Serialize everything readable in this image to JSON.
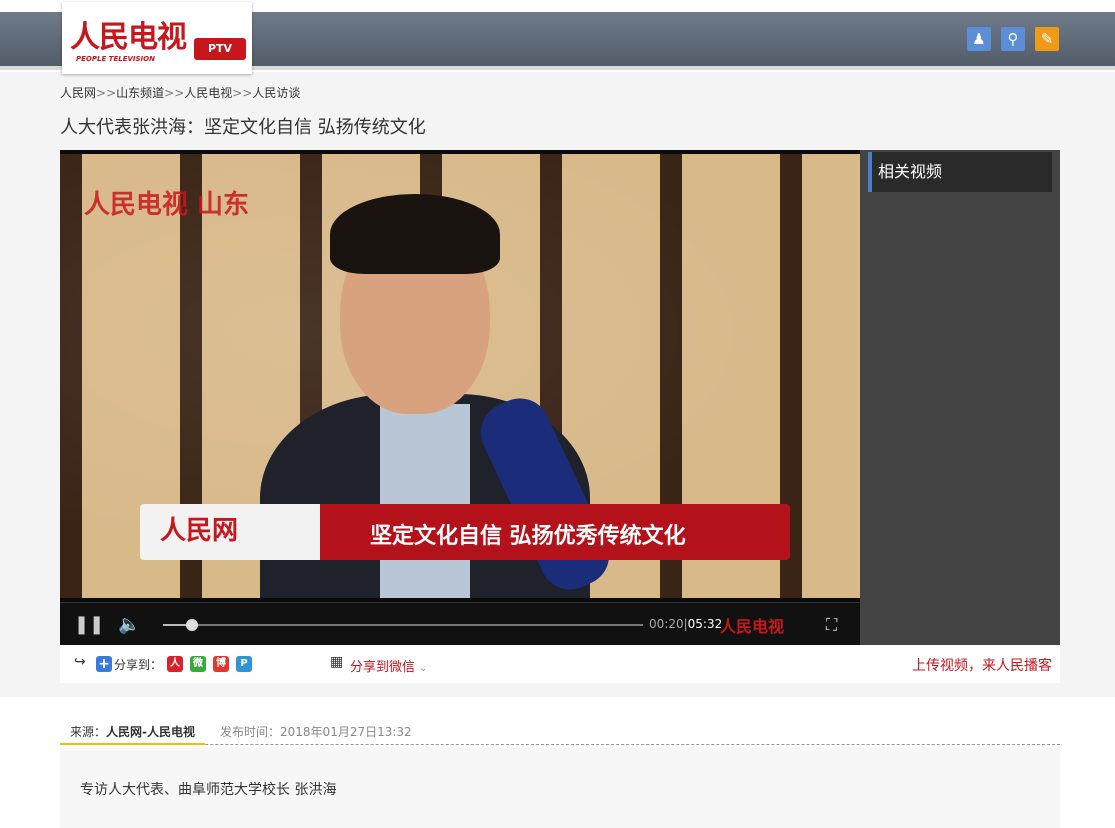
{
  "header": {
    "logo_text": "人民电视",
    "logo_badge": "PTV",
    "logo_sub": "PEOPLE TELEVISION",
    "icons": [
      {
        "name": "user-icon",
        "color": "#5b8ed6"
      },
      {
        "name": "search-icon",
        "color": "#5b8ed6"
      },
      {
        "name": "edit-icon",
        "color": "#f09a1a"
      }
    ]
  },
  "breadcrumb": {
    "items": [
      "人民网",
      "山东频道",
      "人民电视",
      "人民访谈"
    ],
    "separator": ">>"
  },
  "page": {
    "title": "人大代表张洪海：坚定文化自信 弘扬传统文化"
  },
  "player": {
    "watermark": "人民电视 山东",
    "banner_logo": "人民网",
    "banner_text": "坚定文化自信  弘扬优秀传统文化",
    "current_time": "00:20",
    "duration": "05:32",
    "progress_fraction": 0.06,
    "brand_mark": "人民电视"
  },
  "sidebar": {
    "title": "相关视频"
  },
  "share": {
    "label": "分享到：",
    "wechat_label": "分享到微信",
    "upload_text": "上传视频，来人民播客",
    "icons": [
      {
        "name": "people-share-icon",
        "color": "#d8232a",
        "glyph": "人"
      },
      {
        "name": "wechat-icon",
        "color": "#3aa83a",
        "glyph": "微"
      },
      {
        "name": "weibo-icon",
        "color": "#e3372b",
        "glyph": "博"
      },
      {
        "name": "qzone-icon",
        "color": "#2d95d6",
        "glyph": "P"
      }
    ]
  },
  "article": {
    "source_label": "来源：",
    "source_value": "人民网-人民电视",
    "publish_label": "发布时间：",
    "publish_value": "2018年01月27日13:32",
    "summary": "专访人大代表、曲阜师范大学校长 张洪海"
  }
}
